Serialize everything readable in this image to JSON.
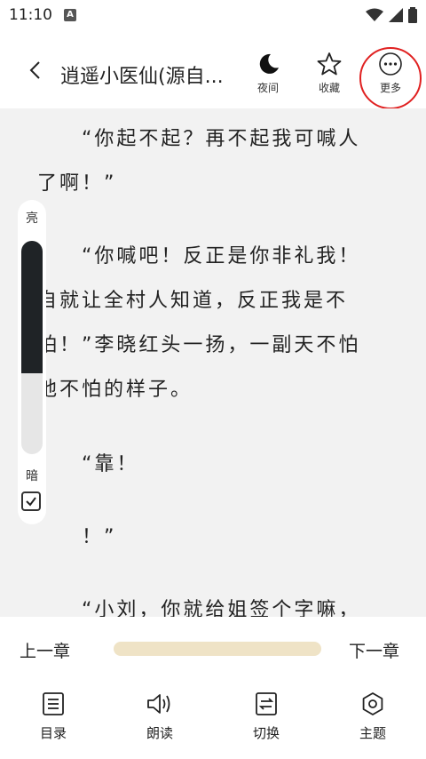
{
  "status": {
    "time": "11:10",
    "notif_icon": "A"
  },
  "header": {
    "title": "逍遥小医仙(源自...",
    "night_label": "夜间",
    "collect_label": "收藏",
    "more_label": "更多"
  },
  "content": {
    "paragraphs": [
      "“你起不起？再不起我可喊人",
      "了啊！”",
      "“你喊吧！反正是你非礼我！",
      "自就让全村人知道，反正我是不",
      "怕！”李晓红头一扬，一副天不怕",
      "地不怕的样子。",
      "“靠！",
      "！”",
      "“小刘，你就给姐签个字嘛，"
    ]
  },
  "brightness": {
    "bright_label": "亮",
    "dark_label": "暗",
    "level": 0.62
  },
  "chapter_nav": {
    "prev_label": "上一章",
    "next_label": "下一章"
  },
  "bottom_nav": {
    "items": [
      {
        "label": "目录",
        "icon": "list-icon"
      },
      {
        "label": "朗读",
        "icon": "speaker-icon"
      },
      {
        "label": "切换",
        "icon": "switch-icon"
      },
      {
        "label": "主题",
        "icon": "theme-icon"
      }
    ]
  }
}
